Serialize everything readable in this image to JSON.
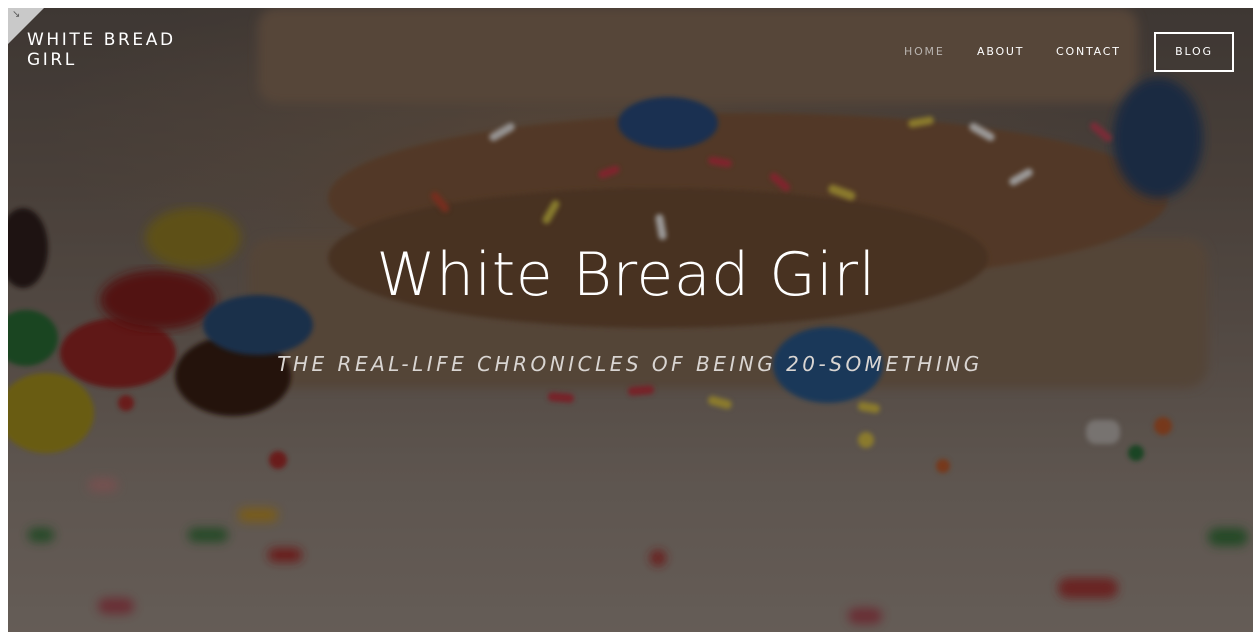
{
  "site": {
    "logo_text": "WHITE BREAD GIRL"
  },
  "nav": {
    "items": [
      {
        "label": "HOME",
        "active": true
      },
      {
        "label": "ABOUT",
        "active": false
      },
      {
        "label": "CONTACT",
        "active": false
      }
    ],
    "blog_label": "BLOG"
  },
  "hero": {
    "title": "White Bread Girl",
    "subtitle": "THE REAL-LIFE CHRONICLES OF BEING 20-SOMETHING"
  },
  "colors": {
    "nav_active": "#b9b4b0",
    "nav_text": "#ffffff",
    "subtitle": "#d9d5d2"
  },
  "icons": {
    "corner_tab": "resize-arrow-icon"
  }
}
